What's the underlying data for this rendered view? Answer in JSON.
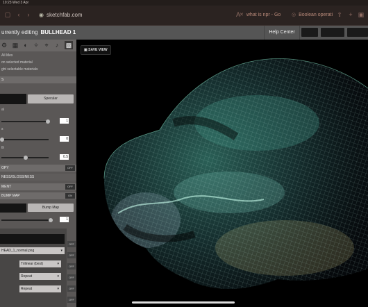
{
  "status": {
    "time": "10:23",
    "date": "Wed 3 Apr"
  },
  "browser": {
    "url": "sketchfab.com",
    "tabs": [
      "what is npr - Go",
      "Boolean operati"
    ],
    "icons": [
      "sidebar-icon",
      "back-icon",
      "forward-icon",
      "text-size-icon",
      "share-icon",
      "add-tab-icon",
      "tabs-icon"
    ]
  },
  "header": {
    "editing_label": "urrently editing",
    "model_name": "BULLHEAD 1",
    "help": "Help Center"
  },
  "panel": {
    "tool_icons": [
      "scene-icon",
      "lighting-icon",
      "materials-icon",
      "wand-icon",
      "pin-icon",
      "sound-icon",
      "vr-icon"
    ],
    "lines": [
      "All Mes",
      "on selected material",
      "ght selectable materials"
    ],
    "specular_label": "Specular",
    "value_1": "1",
    "value_2": "0",
    "value_3": "0.5",
    "value_4": "1",
    "section_s": "S",
    "off": "OFF",
    "on": "ON",
    "opy_label": "OPY",
    "ness_label": "NESS/GLOSSINESS",
    "ment_label": "MENT",
    "bump_label": "BUMP MAP",
    "bump_button": "Bump Map",
    "normal_file": "HEAD_1_normal.png",
    "filter": "Trilinear (best)",
    "wrap1": "Repeat",
    "wrap2": "Repeat",
    "tiny_labels": [
      "al",
      "s",
      "th"
    ]
  },
  "viewport": {
    "save_view": "SAVE VIEW"
  },
  "colors": {
    "mesh_teal": "#4fd1c5",
    "mesh_yellow": "#e8d88c",
    "panel": "#5a5756"
  }
}
